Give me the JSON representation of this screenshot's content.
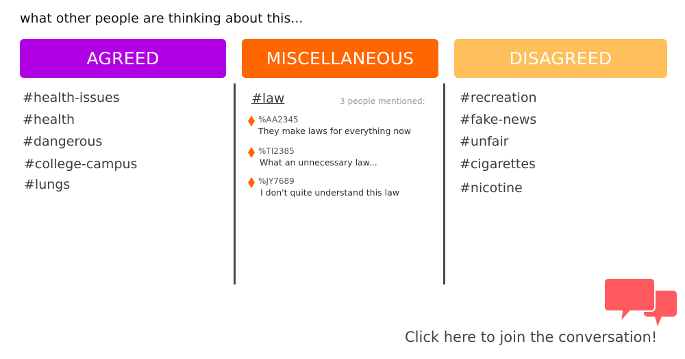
{
  "intro_text": "what other people are thinking about this...",
  "columns": {
    "agreed": {
      "label": "AGREED",
      "color": "#b100e4",
      "tags": [
        "#health-issues",
        "#health",
        "#dangerous",
        "#college-campus",
        "#lungs"
      ]
    },
    "miscellaneous": {
      "label": "MISCELLANEOUS",
      "color": "#ff6600",
      "selected_tag": "#law",
      "mention_count_text": "3 people mentioned:",
      "comments": [
        {
          "id": "%AA2345",
          "text": "They make laws for everything now"
        },
        {
          "id": "%TI2385",
          "text": "What an unnecessary law..."
        },
        {
          "id": "%JY7689",
          "text": "I don't quite understand this law"
        }
      ]
    },
    "disagreed": {
      "label": "DISAGREED",
      "color": "#ffbf5a",
      "tags": [
        "#recreation",
        "#fake-news",
        "#unfair",
        "#cigarettes",
        "#nicotine"
      ]
    }
  },
  "cta": {
    "label": "Click here to join the conversation!",
    "icon": "chat-bubbles-icon",
    "icon_color": "#ff5a5f"
  },
  "comment_marker_icon": "diamond-icon",
  "comment_marker_color": "#ff6600"
}
